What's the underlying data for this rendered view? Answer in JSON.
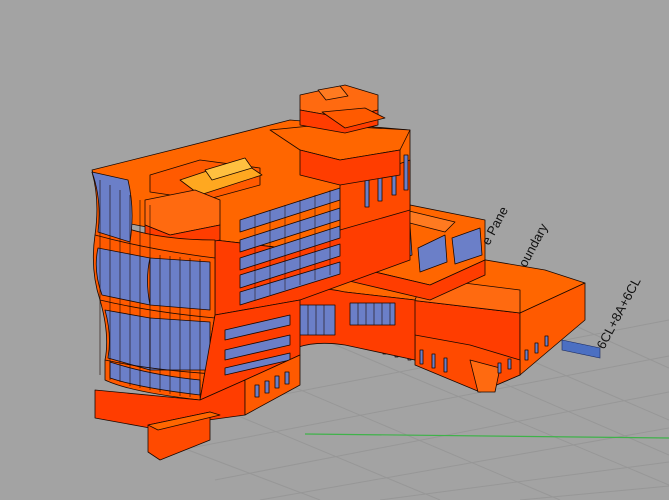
{
  "viewport": {
    "label_texts": {
      "pane": "e Pane",
      "boundary": "oundary",
      "wall_type": "6CL+8A+6CL"
    }
  },
  "colors": {
    "background": "#a3a3a3",
    "grid": "#969696",
    "surface_light": "#ff6600",
    "surface_dark": "#ff3d00",
    "glazing": "#6b7fc8",
    "outline": "#1a0800",
    "skylight": "#ffa820",
    "ground_axis": "#3fb24a",
    "tag": "#4b6fc2"
  }
}
